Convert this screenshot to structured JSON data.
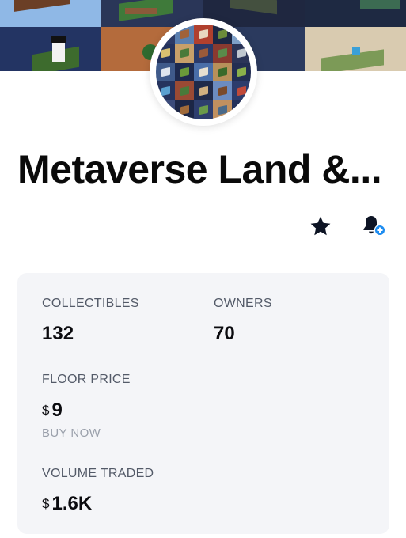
{
  "collection": {
    "title": "Metaverse Land &..."
  },
  "actions": {
    "favorite_icon": "star-icon",
    "notify_icon": "bell-plus-icon",
    "accent_color": "#1d8cf0"
  },
  "stats": {
    "collectibles": {
      "label": "COLLECTIBLES",
      "value": "132"
    },
    "owners": {
      "label": "OWNERS",
      "value": "70"
    },
    "floor_price": {
      "label": "FLOOR PRICE",
      "currency": "$",
      "value": "9",
      "action": "BUY NOW"
    },
    "volume_traded": {
      "label": "VOLUME TRADED",
      "currency": "$",
      "value": "1.6K"
    }
  }
}
